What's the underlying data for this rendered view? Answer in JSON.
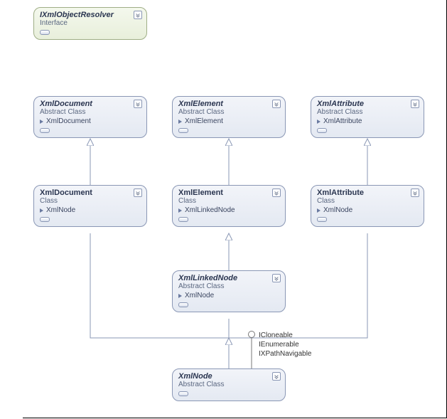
{
  "nodes": {
    "resolver": {
      "title": "IXmlObjectResolver",
      "stereo": "Interface"
    },
    "xmlDocAbs": {
      "title": "XmlDocument",
      "stereo": "Abstract Class",
      "base": "XmlDocument"
    },
    "xmlElemAbs": {
      "title": "XmlElement",
      "stereo": "Abstract Class",
      "base": "XmlElement"
    },
    "xmlAttrAbs": {
      "title": "XmlAttribute",
      "stereo": "Abstract Class",
      "base": "XmlAttribute"
    },
    "xmlDoc": {
      "title": "XmlDocument",
      "stereo": "Class",
      "base": "XmlNode"
    },
    "xmlElem": {
      "title": "XmlElement",
      "stereo": "Class",
      "base": "XmlLinkedNode"
    },
    "xmlAttr": {
      "title": "XmlAttribute",
      "stereo": "Class",
      "base": "XmlNode"
    },
    "xmlLinked": {
      "title": "XmlLinkedNode",
      "stereo": "Abstract Class",
      "base": "XmlNode"
    },
    "xmlNode": {
      "title": "XmlNode",
      "stereo": "Abstract Class"
    }
  },
  "interfaces": {
    "i1": "ICloneable",
    "i2": "IEnumerable",
    "i3": "IXPathNavigable"
  }
}
